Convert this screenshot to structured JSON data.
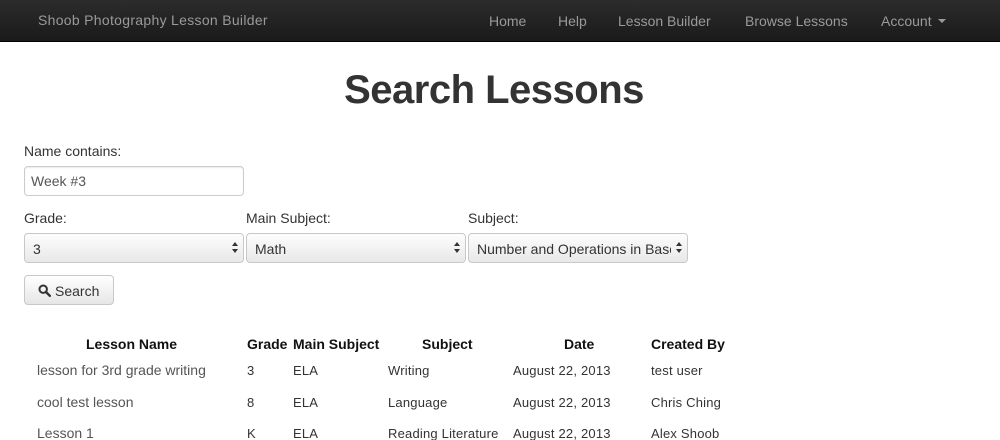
{
  "navbar": {
    "brand": "Shoob Photography Lesson Builder",
    "items": [
      "Home",
      "Help",
      "Lesson Builder",
      "Browse Lessons",
      "Account"
    ]
  },
  "page_title": "Search Lessons",
  "form": {
    "name_label": "Name contains:",
    "name_value": "Week #3",
    "grade_label": "Grade:",
    "grade_value": "3",
    "main_subject_label": "Main Subject:",
    "main_subject_value": "Math",
    "subject_label": "Subject:",
    "subject_value": "Number and Operations in Base Ten",
    "search_label": "Search"
  },
  "table": {
    "headers": [
      "Lesson Name",
      "Grade",
      "Main Subject",
      "Subject",
      "Date",
      "Created By"
    ],
    "rows": [
      [
        "lesson for 3rd grade writing",
        "3",
        "ELA",
        "Writing",
        "August 22, 2013",
        "test user"
      ],
      [
        "cool test lesson",
        "8",
        "ELA",
        "Language",
        "August 22, 2013",
        "Chris Ching"
      ],
      [
        "Lesson 1",
        "K",
        "ELA",
        "Reading Literature",
        "August 22, 2013",
        "Alex Shoob"
      ]
    ]
  },
  "colors": {
    "navbar_bg": "#1e1e1e",
    "nav_text": "#9a9a9a",
    "title_text": "#333333"
  }
}
